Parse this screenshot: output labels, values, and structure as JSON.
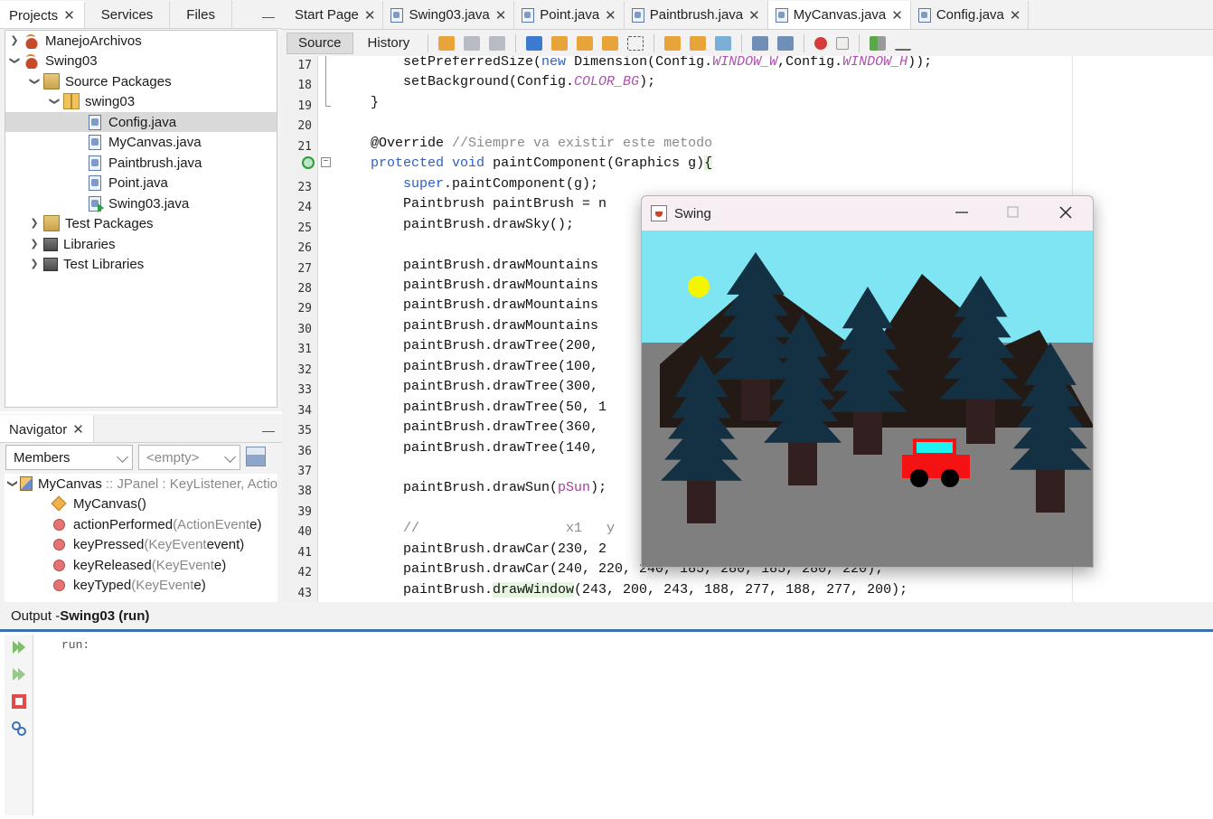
{
  "projects_panel": {
    "tabs": [
      "Projects",
      "Services",
      "Files"
    ],
    "tree": [
      {
        "label": "ManejoArchivos",
        "type": "project",
        "depth": 0,
        "expanded": false
      },
      {
        "label": "Swing03",
        "type": "project",
        "depth": 0,
        "expanded": true
      },
      {
        "label": "Source Packages",
        "type": "folder",
        "depth": 1,
        "expanded": true
      },
      {
        "label": "swing03",
        "type": "package",
        "depth": 2,
        "expanded": true
      },
      {
        "label": "Config.java",
        "type": "file",
        "depth": 3,
        "selected": true
      },
      {
        "label": "MyCanvas.java",
        "type": "file",
        "depth": 3
      },
      {
        "label": "Paintbrush.java",
        "type": "file",
        "depth": 3
      },
      {
        "label": "Point.java",
        "type": "file",
        "depth": 3
      },
      {
        "label": "Swing03.java",
        "type": "file-main",
        "depth": 3
      },
      {
        "label": "Test Packages",
        "type": "folder",
        "depth": 1,
        "expanded": false
      },
      {
        "label": "Libraries",
        "type": "library",
        "depth": 1,
        "expanded": false
      },
      {
        "label": "Test Libraries",
        "type": "library",
        "depth": 1,
        "expanded": false
      }
    ]
  },
  "navigator": {
    "tab_label": "Navigator",
    "filter_value": "Members",
    "scope_value": "<empty>",
    "class_name": "MyCanvas",
    "class_suffix": ":: JPanel : KeyListener, Actio",
    "members": [
      {
        "name": "MyCanvas()",
        "params": "",
        "kind": "constructor"
      },
      {
        "name": "actionPerformed",
        "params": "(ActionEvent",
        "arg": " e)",
        "kind": "method"
      },
      {
        "name": "keyPressed",
        "params": "(KeyEvent",
        "arg": " event)",
        "kind": "method"
      },
      {
        "name": "keyReleased",
        "params": "(KeyEvent",
        "arg": " e)",
        "kind": "method"
      },
      {
        "name": "keyTyped",
        "params": "(KeyEvent",
        "arg": " e)",
        "kind": "method"
      }
    ]
  },
  "editor": {
    "tabs": [
      "Start Page",
      "Swing03.java",
      "Point.java",
      "Paintbrush.java",
      "MyCanvas.java",
      "Config.java"
    ],
    "active_tab": "MyCanvas.java",
    "view_tabs": [
      "Source",
      "History"
    ],
    "active_view": "Source",
    "line_numbers": [
      "17",
      "18",
      "19",
      "20",
      "21",
      "",
      "23",
      "24",
      "25",
      "26",
      "27",
      "28",
      "29",
      "30",
      "31",
      "32",
      "33",
      "34",
      "35",
      "36",
      "37",
      "38",
      "39",
      "40",
      "41",
      "42",
      "43"
    ],
    "code_lines": [
      "        setPreferredSize(new Dimension(Config.WINDOW_W,Config.WINDOW_H));",
      "        setBackground(Config.COLOR_BG);",
      "    }",
      "",
      "    @Override //Siempre va existir este metodo",
      "    protected void paintComponent(Graphics g){",
      "        super.paintComponent(g);",
      "        Paintbrush paintBrush = n",
      "        paintBrush.drawSky();",
      "",
      "        paintBrush.drawMountains",
      "        paintBrush.drawMountains",
      "        paintBrush.drawMountains",
      "        paintBrush.drawMountains",
      "        paintBrush.drawTree(200,",
      "        paintBrush.drawTree(100,",
      "        paintBrush.drawTree(300,",
      "        paintBrush.drawTree(50, 1",
      "        paintBrush.drawTree(360,",
      "        paintBrush.drawTree(140,",
      "",
      "        paintBrush.drawSun(pSun);",
      "",
      "        //                  x1   y",
      "        paintBrush.drawCar(230, 2",
      "        paintBrush.drawCar(240, 220, 240, 185, 280, 185, 280, 220);",
      "        paintBrush.drawWindow(243, 200, 243, 188, 277, 188, 277, 200);"
    ]
  },
  "swing_window": {
    "title": "Swing",
    "colors": {
      "sky": "#7fe5f3",
      "ground": "#7f7f7f",
      "mountain": "#231a16",
      "tree": "#133142",
      "trunk": "#321f20",
      "sun": "#f5f500",
      "car": "#f51212",
      "window": "#1ff0f0",
      "wheel": "#000000"
    }
  },
  "output": {
    "title_prefix": "Output - ",
    "title_run": "Swing03 (run)",
    "text": "run:"
  }
}
